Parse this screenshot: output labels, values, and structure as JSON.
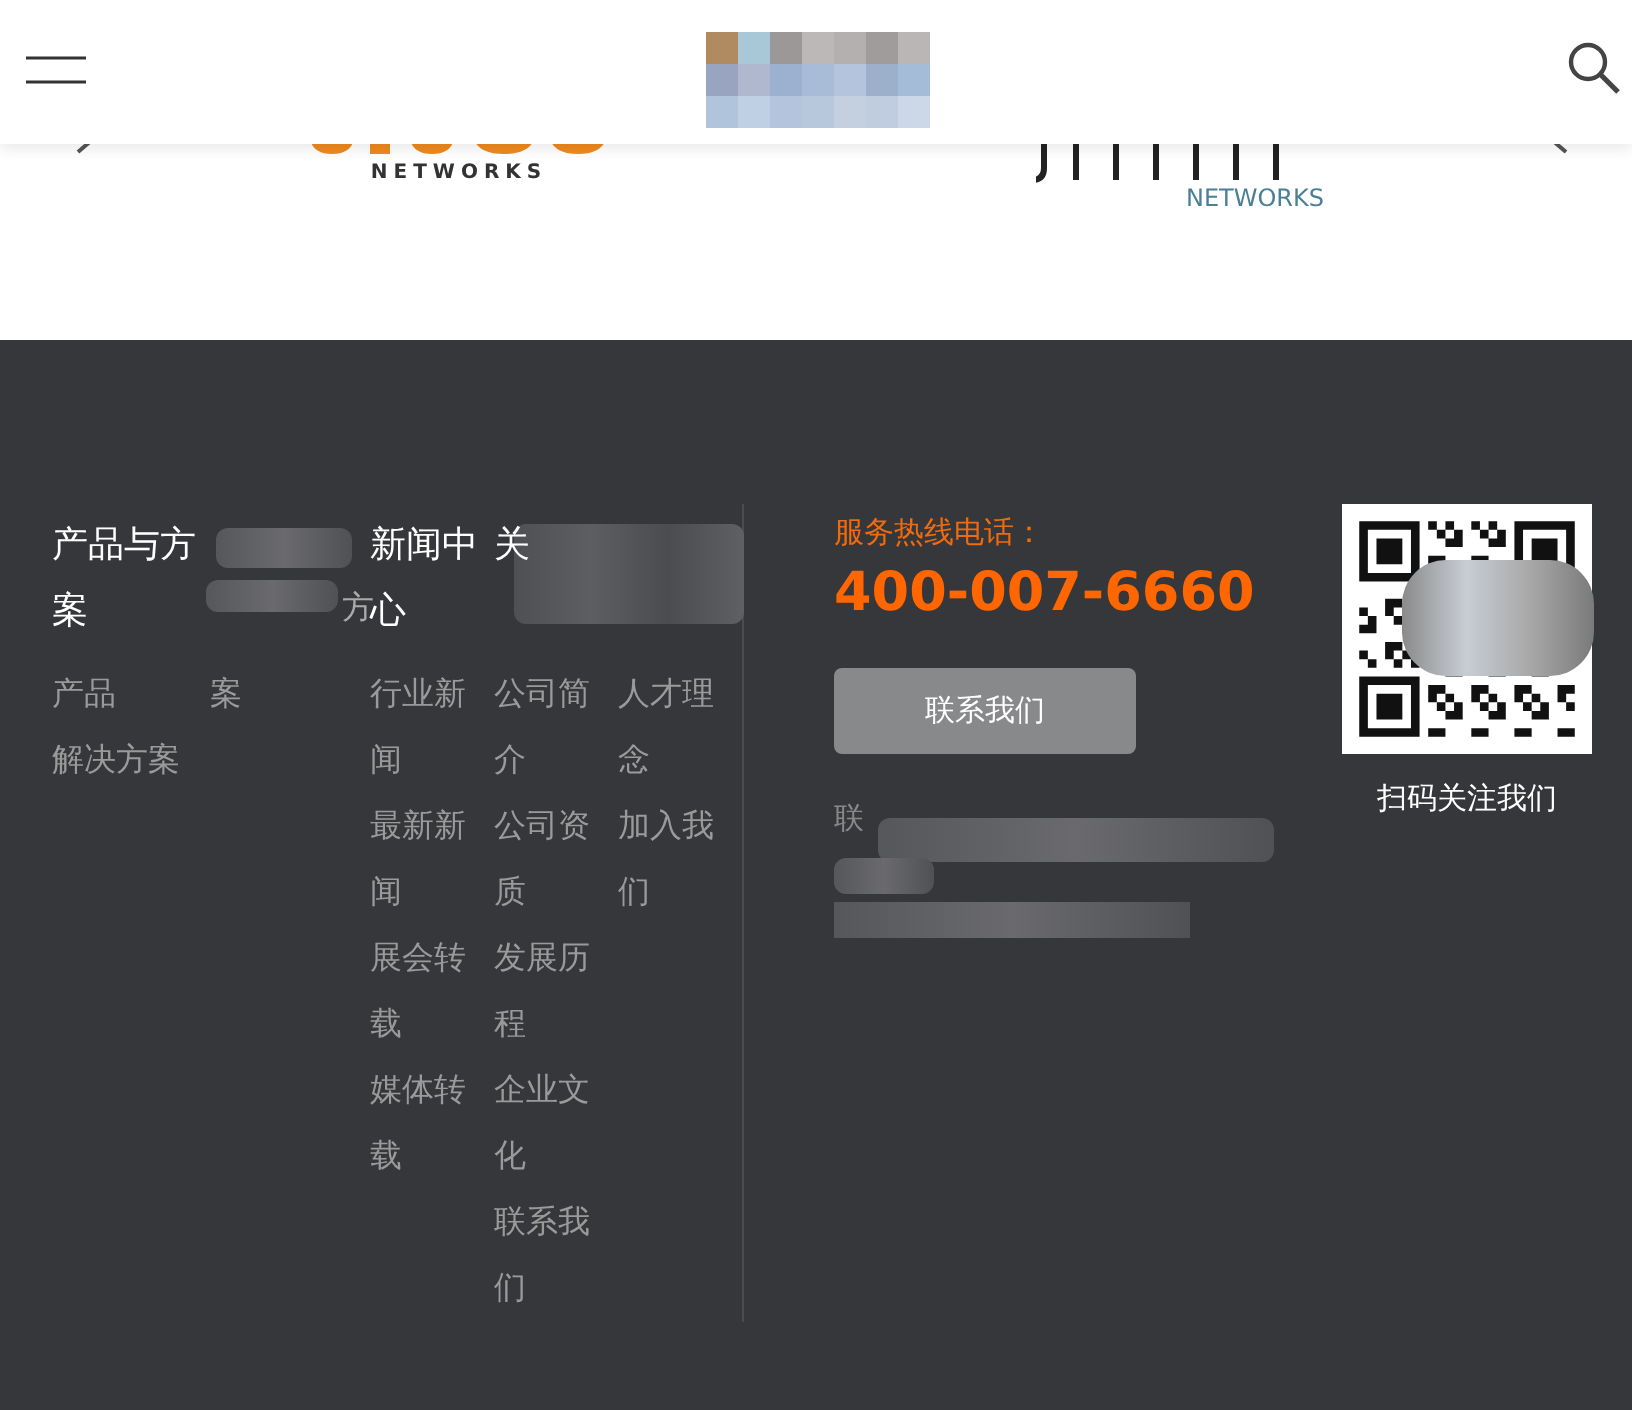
{
  "carousel": {
    "logos": [
      {
        "kind": "aruba",
        "caption": "NETWORKS"
      },
      {
        "kind": "juniper",
        "caption": "NETWORKS"
      }
    ]
  },
  "footer": {
    "columns": [
      {
        "title": "产品与方案",
        "items": [
          "产品",
          "解决方案"
        ]
      },
      {
        "title_fragment": "方",
        "items": [
          "案"
        ]
      },
      {
        "title": "新闻中心",
        "items": [
          "行业新闻",
          "最新新闻",
          "展会转载",
          "媒体转载"
        ]
      },
      {
        "title_fragment": "关",
        "items": [
          "公司简介",
          "公司资质",
          "发展历程",
          "企业文化",
          "联系我们"
        ]
      },
      {
        "items": [
          "人才理念",
          "加入我们"
        ]
      }
    ],
    "hotline_label": "服务热线电话：",
    "hotline": "400-007-6660",
    "contact_button": "联系我们",
    "address_fragment": "联",
    "qr_caption": "扫码关注我们"
  }
}
